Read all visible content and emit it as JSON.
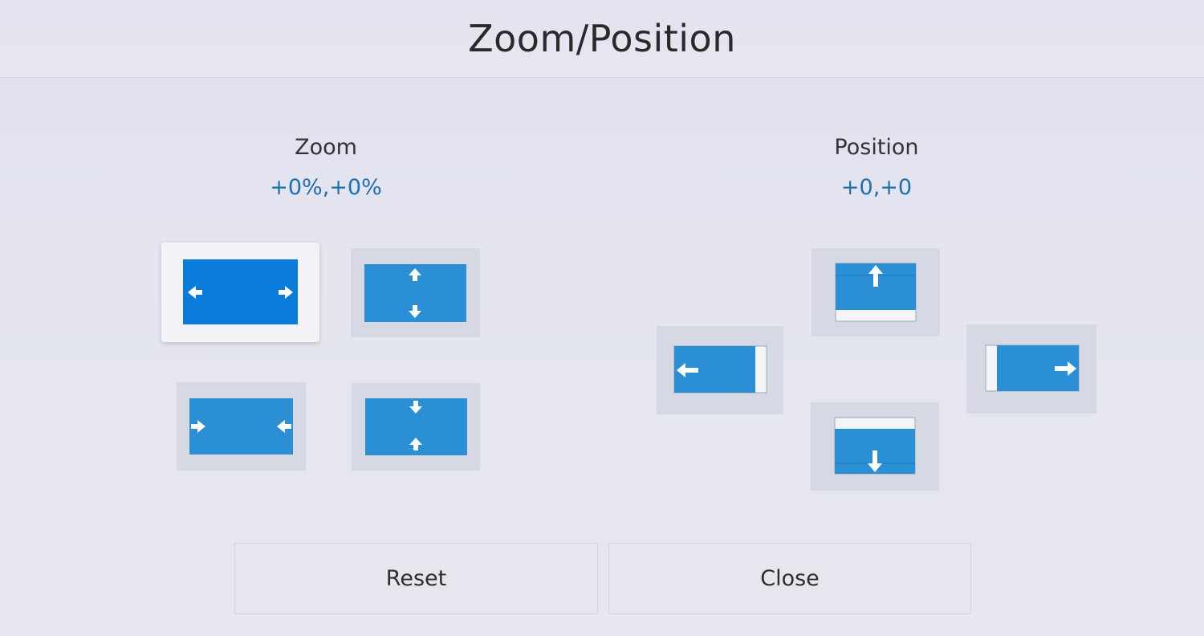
{
  "title": "Zoom/Position",
  "zoom": {
    "label": "Zoom",
    "value": "+0%,+0%",
    "controls": [
      {
        "name": "zoom-horizontal-expand",
        "icon": "arrows-out-horizontal-icon",
        "focused": true
      },
      {
        "name": "zoom-vertical-expand",
        "icon": "arrows-out-vertical-icon",
        "focused": false
      },
      {
        "name": "zoom-horizontal-shrink",
        "icon": "arrows-in-horizontal-icon",
        "focused": false
      },
      {
        "name": "zoom-vertical-shrink",
        "icon": "arrows-in-vertical-icon",
        "focused": false
      }
    ]
  },
  "position": {
    "label": "Position",
    "value": "+0,+0",
    "controls": [
      {
        "name": "position-up",
        "icon": "arrow-up-icon"
      },
      {
        "name": "position-left",
        "icon": "arrow-left-icon"
      },
      {
        "name": "position-right",
        "icon": "arrow-right-icon"
      },
      {
        "name": "position-down",
        "icon": "arrow-down-icon"
      }
    ]
  },
  "buttons": {
    "reset": "Reset",
    "close": "Close"
  },
  "colors": {
    "accent_blue": "#1f6fae",
    "screen_blue": "#2b8fd6",
    "screen_blue_focused": "#0a7ddc",
    "tile_bg": "#d6d8e4"
  }
}
